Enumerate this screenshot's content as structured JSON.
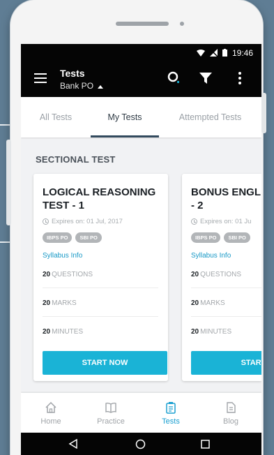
{
  "status": {
    "time": "19:46"
  },
  "appbar": {
    "title": "Tests",
    "subtitle": "Bank PO"
  },
  "tabs": [
    {
      "label": "All Tests",
      "active": false
    },
    {
      "label": "My Tests",
      "active": true
    },
    {
      "label": "Attempted Tests",
      "active": false
    }
  ],
  "section_title": "SECTIONAL TEST",
  "cards": [
    {
      "name_line1": "LOGICAL REASONING",
      "name_line2": "TEST - 1",
      "expiry": "Expires on: 01 Jul, 2017",
      "badges": [
        "IBPS PO",
        "SBI PO"
      ],
      "syllabus": "Syllabus Info",
      "questions_count": "20",
      "questions_label": "QUESTIONS",
      "marks_count": "20",
      "marks_label": "MARKS",
      "minutes_count": "20",
      "minutes_label": "MINUTES",
      "button": "START NOW"
    },
    {
      "name_line1": "BONUS ENGL",
      "name_line2": "- 2",
      "expiry": "Expires on: 01 Ju",
      "badges": [
        "IBPS PO",
        "SBI PO"
      ],
      "syllabus": "Syllabus Info",
      "questions_count": "20",
      "questions_label": "QUESTIONS",
      "marks_count": "20",
      "marks_label": "MARKS",
      "minutes_count": "20",
      "minutes_label": "MINUTES",
      "button": "START"
    }
  ],
  "bottom_nav": [
    {
      "label": "Home",
      "icon": "home-icon"
    },
    {
      "label": "Practice",
      "icon": "book-icon"
    },
    {
      "label": "Tests",
      "icon": "clipboard-icon",
      "active": true
    },
    {
      "label": "Blog",
      "icon": "document-icon"
    }
  ],
  "colors": {
    "accent": "#1ab3d6",
    "tab_indicator": "#334a5e",
    "background": "#5f7d94"
  }
}
